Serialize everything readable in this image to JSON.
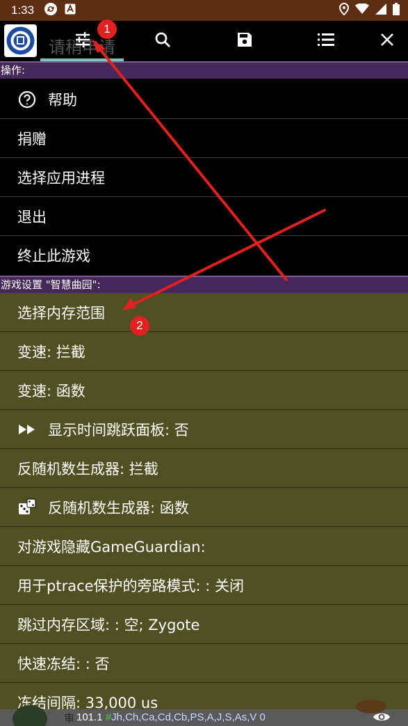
{
  "status_bar": {
    "time": "1:33",
    "icons": [
      "sync-icon",
      "notification-a-icon",
      "location-icon",
      "wifi-icon",
      "signal-icon",
      "battery-icon"
    ]
  },
  "toolbar": {
    "tab_title": "请稍申请",
    "buttons": [
      "settings-sliders-icon",
      "search-icon",
      "save-icon",
      "list-icon",
      "close-icon"
    ]
  },
  "sections": {
    "operations_header": "操作:",
    "operations": [
      {
        "label": "帮助",
        "icon": "help-circle-icon"
      },
      {
        "label": "捐赠"
      },
      {
        "label": "选择应用进程"
      },
      {
        "label": "退出"
      },
      {
        "label": "终止此游戏"
      }
    ],
    "game_settings_header": "游戏设置 \"智慧曲园\":",
    "game_settings": [
      {
        "label": "选择内存范围"
      },
      {
        "label": "变速: 拦截"
      },
      {
        "label": "变速: 函数"
      },
      {
        "label": "显示时间跳跃面板: 否",
        "icon": "fast-forward-icon"
      },
      {
        "label": "反随机数生成器: 拦截"
      },
      {
        "label": "反随机数生成器: 函数",
        "icon": "dice-icon"
      },
      {
        "label": "对游戏隐藏GameGuardian:"
      },
      {
        "label": "用于ptrace保护的旁路模式: : 关闭"
      },
      {
        "label": "跳过内存区域: : 空; Zygote"
      },
      {
        "label": "快速冻结: : 否"
      },
      {
        "label": "冻结间隔:  33,000 us"
      }
    ]
  },
  "bottom_bar": {
    "ghost_text": "审",
    "value": "101.1",
    "hash": "#",
    "flags": "Jh,Ch,Ca,Cd,Cb,PS,A,J,S,As,V 0"
  },
  "annotations": {
    "badge_1": "1",
    "badge_2": "2",
    "arrow_color": "#e32020"
  },
  "colors": {
    "status_bar": "#5d2e12",
    "section_header": "#44295a",
    "settings_bg": "#505022",
    "tab_indicator": "#7fc4bb"
  }
}
